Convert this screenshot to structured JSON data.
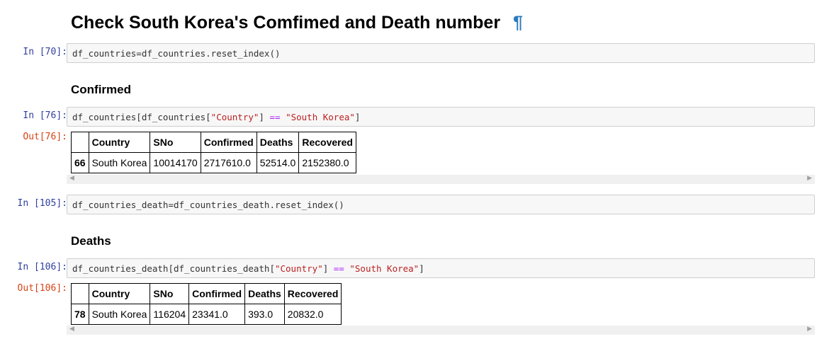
{
  "title": "Check South Korea's Comfimed and Death number",
  "pilcrow": "¶",
  "sections": {
    "confirmed": "Confirmed",
    "deaths": "Deaths"
  },
  "cells": [
    {
      "prompt": "In [70]:",
      "code_plain": "df_countries=df_countries.reset_index()"
    },
    {
      "prompt": "In [76]:",
      "code_pre": "df_countries[df_countries[",
      "code_str1": "\"Country\"",
      "code_mid": "] ",
      "code_op": "==",
      "code_sp": " ",
      "code_str2": "\"South Korea\"",
      "code_post": "]"
    },
    {
      "prompt": "In [105]:",
      "code_plain": "df_countries_death=df_countries_death.reset_index()"
    },
    {
      "prompt": "In [106]:",
      "code_pre": "df_countries_death[df_countries_death[",
      "code_str1": "\"Country\"",
      "code_mid": "] ",
      "code_op": "==",
      "code_sp": " ",
      "code_str2": "\"South Korea\"",
      "code_post": "]"
    }
  ],
  "outputs": [
    {
      "prompt": "Out[76]:",
      "columns": [
        "",
        "Country",
        "SNo",
        "Confirmed",
        "Deaths",
        "Recovered"
      ],
      "row": {
        "index": "66",
        "cells": [
          "South Korea",
          "10014170",
          "2717610.0",
          "52514.0",
          "2152380.0"
        ]
      }
    },
    {
      "prompt": "Out[106]:",
      "columns": [
        "",
        "Country",
        "SNo",
        "Confirmed",
        "Deaths",
        "Recovered"
      ],
      "row": {
        "index": "78",
        "cells": [
          "South Korea",
          "116204",
          "23341.0",
          "393.0",
          "20832.0"
        ]
      }
    }
  ],
  "scroll_arrows": {
    "left": "◀",
    "right": "▶"
  },
  "colors": {
    "prompt_in": "#303f9f",
    "prompt_out": "#d84315",
    "string": "#ba2121",
    "operator": "#aa22ff",
    "anchor": "#2a7bbf"
  }
}
